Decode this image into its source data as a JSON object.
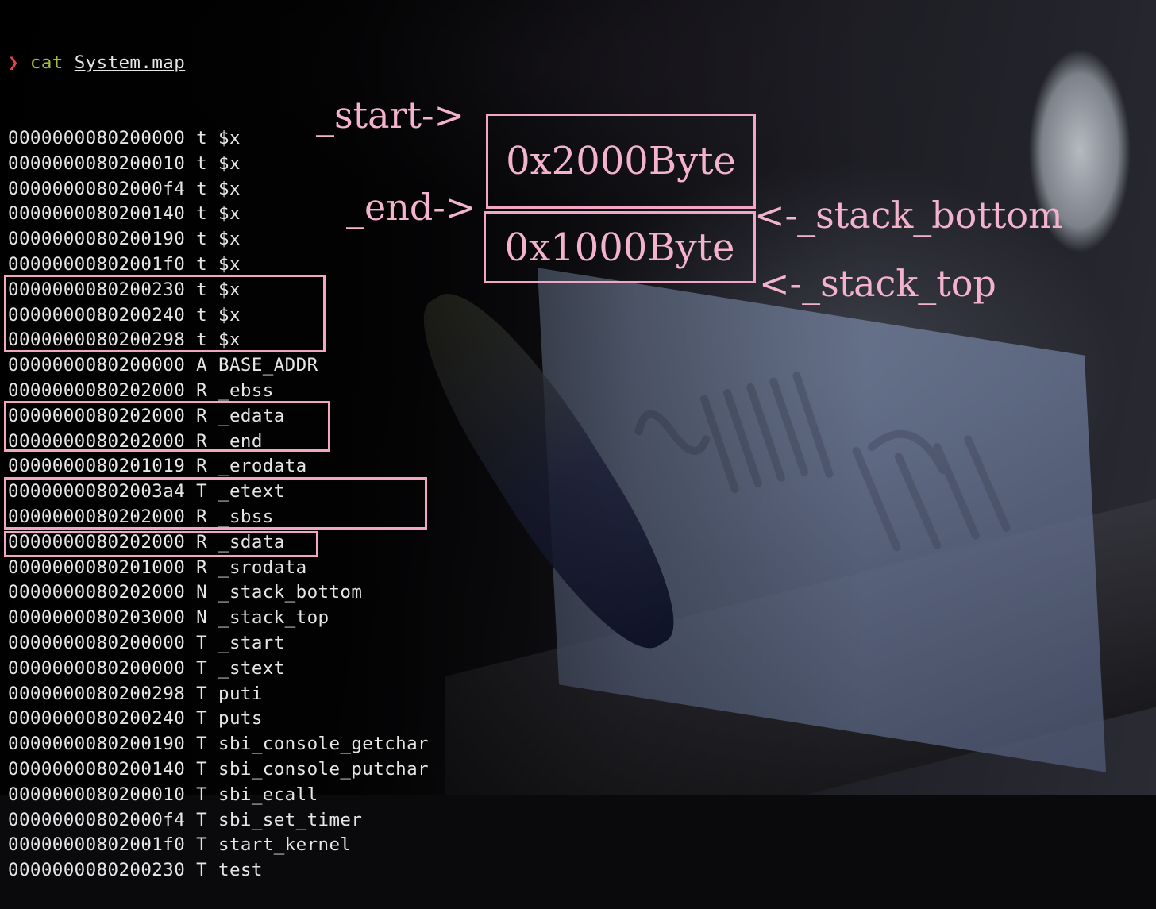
{
  "terminal": {
    "prompt_symbol": "❯",
    "command": "cat",
    "argument": "System.map",
    "rows": [
      {
        "addr": "0000000080200000",
        "type": "t",
        "name": "$x"
      },
      {
        "addr": "0000000080200010",
        "type": "t",
        "name": "$x"
      },
      {
        "addr": "00000000802000f4",
        "type": "t",
        "name": "$x"
      },
      {
        "addr": "0000000080200140",
        "type": "t",
        "name": "$x"
      },
      {
        "addr": "0000000080200190",
        "type": "t",
        "name": "$x"
      },
      {
        "addr": "00000000802001f0",
        "type": "t",
        "name": "$x"
      },
      {
        "addr": "0000000080200230",
        "type": "t",
        "name": "$x"
      },
      {
        "addr": "0000000080200240",
        "type": "t",
        "name": "$x"
      },
      {
        "addr": "0000000080200298",
        "type": "t",
        "name": "$x"
      },
      {
        "addr": "0000000080200000",
        "type": "A",
        "name": "BASE_ADDR"
      },
      {
        "addr": "0000000080202000",
        "type": "R",
        "name": "_ebss"
      },
      {
        "addr": "0000000080202000",
        "type": "R",
        "name": "_edata"
      },
      {
        "addr": "0000000080202000",
        "type": "R",
        "name": "_end"
      },
      {
        "addr": "0000000080201019",
        "type": "R",
        "name": "_erodata"
      },
      {
        "addr": "00000000802003a4",
        "type": "T",
        "name": "_etext"
      },
      {
        "addr": "0000000080202000",
        "type": "R",
        "name": "_sbss"
      },
      {
        "addr": "0000000080202000",
        "type": "R",
        "name": "_sdata"
      },
      {
        "addr": "0000000080201000",
        "type": "R",
        "name": "_srodata"
      },
      {
        "addr": "0000000080202000",
        "type": "N",
        "name": "_stack_bottom"
      },
      {
        "addr": "0000000080203000",
        "type": "N",
        "name": "_stack_top"
      },
      {
        "addr": "0000000080200000",
        "type": "T",
        "name": "_start"
      },
      {
        "addr": "0000000080200000",
        "type": "T",
        "name": "_stext"
      },
      {
        "addr": "0000000080200298",
        "type": "T",
        "name": "puti"
      },
      {
        "addr": "0000000080200240",
        "type": "T",
        "name": "puts"
      },
      {
        "addr": "0000000080200190",
        "type": "T",
        "name": "sbi_console_getchar"
      },
      {
        "addr": "0000000080200140",
        "type": "T",
        "name": "sbi_console_putchar"
      },
      {
        "addr": "0000000080200010",
        "type": "T",
        "name": "sbi_ecall"
      },
      {
        "addr": "00000000802000f4",
        "type": "T",
        "name": "sbi_set_timer"
      },
      {
        "addr": "00000000802001f0",
        "type": "T",
        "name": "start_kernel"
      },
      {
        "addr": "0000000080200230",
        "type": "T",
        "name": "test"
      }
    ]
  },
  "annotations": {
    "start_label": "_start->",
    "end_label": "_end->",
    "upper_block": "0x2000Byte",
    "lower_block": "0x1000Byte",
    "stack_bottom_label": "<-_stack_bottom",
    "stack_top_label": "<-_stack_top"
  },
  "colors": {
    "highlight": "#f1a6c4",
    "prompt_arrow": "#e04848",
    "prompt_command": "#a8b83a",
    "terminal_text": "#e6e6e6"
  }
}
